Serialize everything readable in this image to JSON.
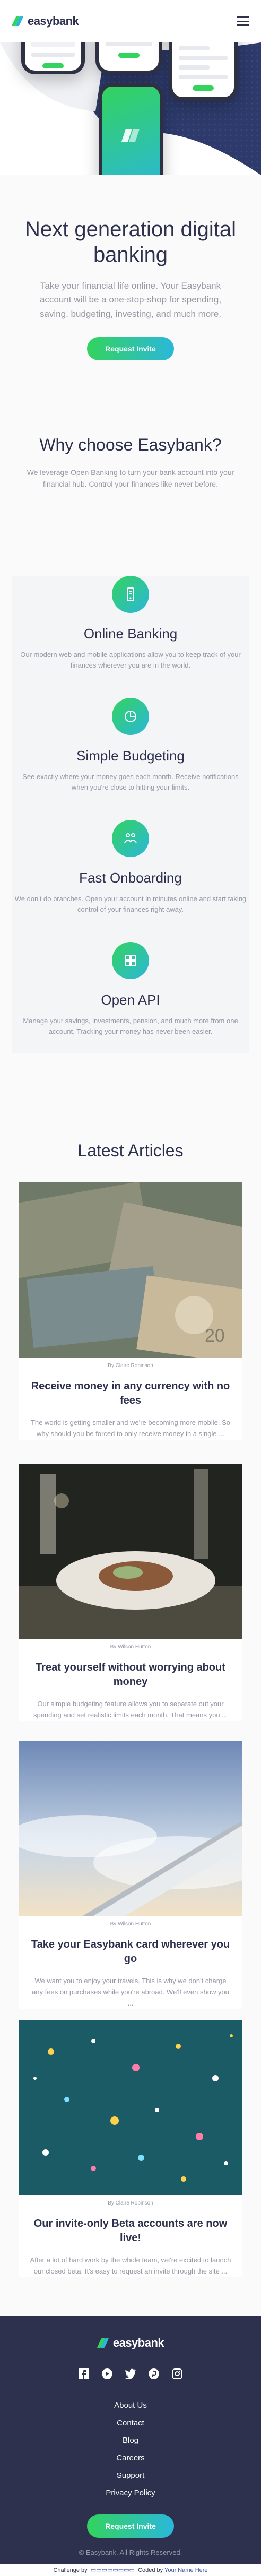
{
  "brand": {
    "name": "easybank"
  },
  "nav": {
    "menu_icon": "hamburger-icon"
  },
  "hero": {
    "title": "Next generation digital banking",
    "description": "Take your financial life online. Your Easybank account will be a one-stop-shop for spending, saving, budgeting, investing, and much more.",
    "cta_label": "Request Invite"
  },
  "why": {
    "title": "Why choose Easybank?",
    "description": "We leverage Open Banking to turn your bank account into your financial hub. Control your finances like never before."
  },
  "features": [
    {
      "icon": "online-banking-icon",
      "title": "Online Banking",
      "description": "Our modern web and mobile applications allow you to keep track of your finances wherever you are in the world."
    },
    {
      "icon": "budgeting-icon",
      "title": "Simple Budgeting",
      "description": "See exactly where your money goes each month. Receive notifications when you're close to hitting your limits."
    },
    {
      "icon": "onboarding-icon",
      "title": "Fast Onboarding",
      "description": "We don't do branches. Open your account in minutes online and start taking control of your finances right away."
    },
    {
      "icon": "api-icon",
      "title": "Open API",
      "description": "Manage your savings, investments, pension, and much more from one account. Tracking your money has never been easier."
    }
  ],
  "articles": {
    "title": "Latest Articles",
    "items": [
      {
        "author": "By Claire Robinson",
        "title": "Receive money in any currency with no fees",
        "description": "The world is getting smaller and we're becoming more mobile. So why should you be forced to only receive money in a single ..."
      },
      {
        "author": "By Wilson Hutton",
        "title": "Treat yourself without worrying about money",
        "description": "Our simple budgeting feature allows you to separate out your spending and set realistic limits each month. That means you ..."
      },
      {
        "author": "By Wilson Hutton",
        "title": "Take your Easybank card wherever you go",
        "description": "We want you to enjoy your travels. This is why we don't charge any fees on purchases while you're abroad. We'll even show you ..."
      },
      {
        "author": "By Claire Robinson",
        "title": "Our invite-only Beta accounts are now live!",
        "description": "After a lot of hard work by the whole team, we're excited to launch our closed beta. It's easy to request an invite through the site ..."
      }
    ]
  },
  "footer": {
    "socials": [
      "facebook-icon",
      "youtube-icon",
      "twitter-icon",
      "pinterest-icon",
      "instagram-icon"
    ],
    "links": [
      "About Us",
      "Contact",
      "Blog",
      "Careers",
      "Support",
      "Privacy Policy"
    ],
    "cta_label": "Request Invite",
    "copyright": "© Easybank. All Rights Reserved.",
    "attribution_prefix": "Challenge by",
    "attribution_mid": "Coded by",
    "attribution_author": "Your Name Here"
  },
  "colors": {
    "navy": "#2d314d",
    "green": "#33d35e",
    "cyan": "#2bb7da",
    "gray": "#9698a6",
    "light": "#f4f5f7"
  }
}
